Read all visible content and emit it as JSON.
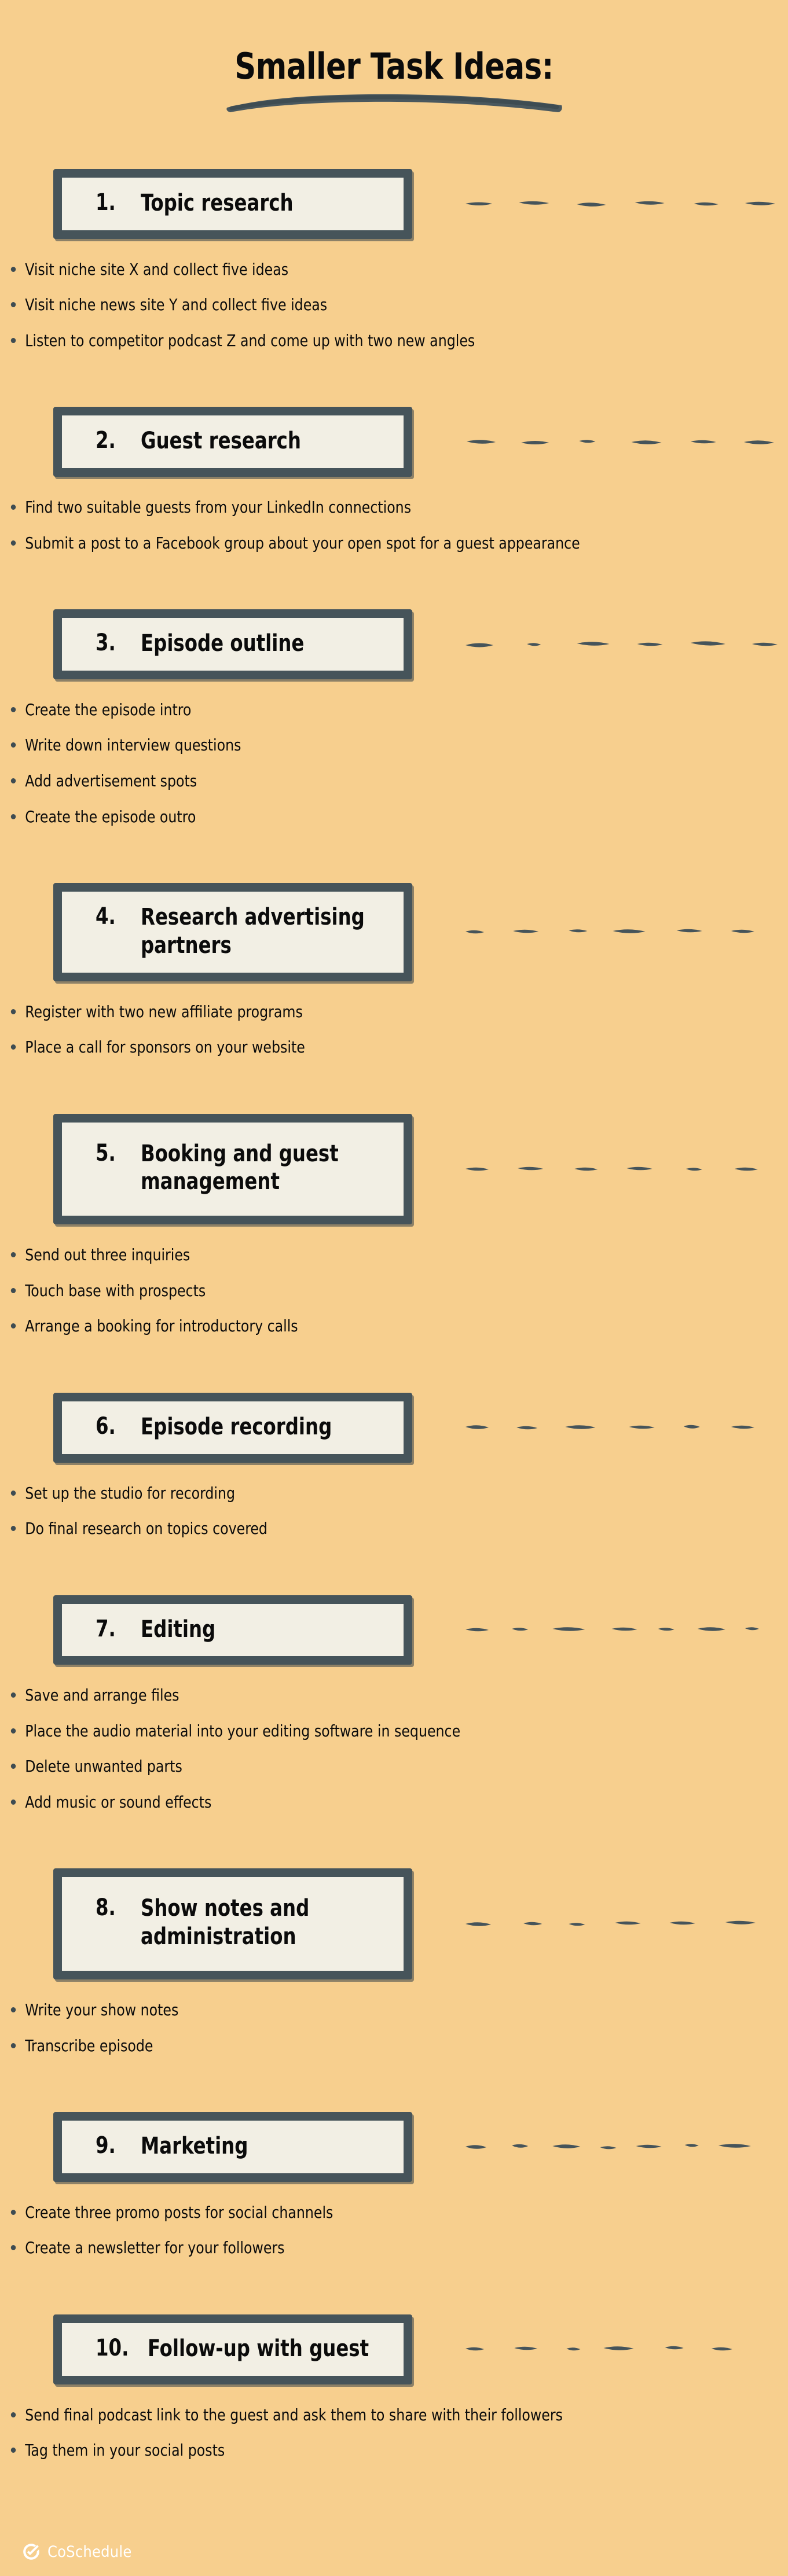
{
  "page": {
    "background_color": "#f7cf8e",
    "ink_color": "#46545a",
    "box_fill_color": "#f2efe4",
    "text_color": "#0b0b0b"
  },
  "header": {
    "title": "Smaller Task Ideas:",
    "underline_icon": "brush-stroke-underline"
  },
  "sections": [
    {
      "number": "1.",
      "title": "Topic research",
      "bullets": [
        "Visit niche site X and collect five ideas",
        "Visit niche news site Y and collect five ideas",
        "Listen to competitor podcast Z and come up with two new angles"
      ]
    },
    {
      "number": "2.",
      "title": "Guest research",
      "bullets": [
        "Find two suitable guests from your LinkedIn connections",
        "Submit a post to a Facebook group about your open\nspot for a guest appearance"
      ]
    },
    {
      "number": "3.",
      "title": "Episode outline",
      "bullets": [
        "Create the episode intro",
        "Write down interview questions",
        "Add advertisement spots",
        "Create the episode outro"
      ]
    },
    {
      "number": "4.",
      "title": "Research advertising partners",
      "bullets": [
        "Register with two new affiliate programs",
        "Place a call for sponsors on your website"
      ]
    },
    {
      "number": "5.",
      "title": "Booking and guest\nmanagement",
      "bullets": [
        "Send out three inquiries",
        "Touch base with prospects",
        "Arrange a booking for introductory calls"
      ]
    },
    {
      "number": "6.",
      "title": "Episode recording",
      "bullets": [
        "Set up the studio for recording",
        "Do final research on topics covered"
      ]
    },
    {
      "number": "7.",
      "title": "Editing",
      "bullets": [
        "Save and arrange files",
        "Place the audio material into your editing software in sequence",
        "Delete unwanted parts",
        "Add music or sound effects"
      ]
    },
    {
      "number": "8.",
      "title": "Show notes and\nadministration",
      "bullets": [
        "Write your show notes",
        "Transcribe episode"
      ]
    },
    {
      "number": "9.",
      "title": "Marketing",
      "bullets": [
        "Create three promo posts for social channels",
        "Create a newsletter for your followers"
      ]
    },
    {
      "number": "10.",
      "title": "Follow-up with guest",
      "bullets": [
        "Send final podcast link to the guest and ask them to\nshare with their followers",
        "Tag them in your social posts"
      ]
    }
  ],
  "footer": {
    "logo_icon": "coschedule-check-circle-icon",
    "brand": "CoSchedule",
    "logo_color": "#ffffff"
  }
}
